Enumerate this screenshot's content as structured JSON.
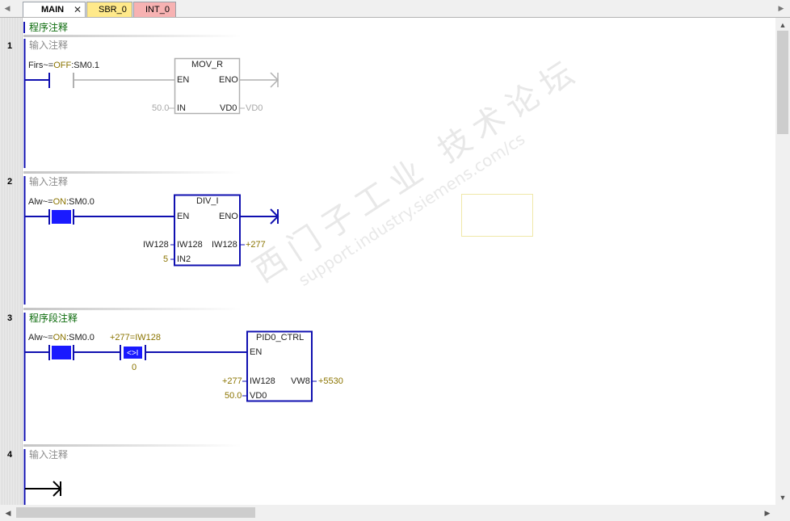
{
  "tabs": [
    {
      "label": "MAIN",
      "active": true,
      "closable": true
    },
    {
      "label": "SBR_0",
      "active": false
    },
    {
      "label": "INT_0",
      "active": false
    }
  ],
  "program_comment": "程序注释",
  "networks": [
    {
      "number": "1",
      "comment": "输入注释",
      "contact": {
        "label_prefix": "Firs~=",
        "state": "OFF",
        "address": ":SM0.1"
      },
      "box": {
        "name": "MOV_R",
        "en": "EN",
        "eno": "ENO",
        "in_label": "IN",
        "out_label": "VD0",
        "in_value": "50.0",
        "out_value": "VD0"
      }
    },
    {
      "number": "2",
      "comment": "输入注释",
      "contact": {
        "label_prefix": "Alw~=",
        "state": "ON",
        "address": ":SM0.0"
      },
      "box": {
        "name": "DIV_I",
        "en": "EN",
        "eno": "ENO",
        "in1_label": "IW128",
        "in2_label": "IN2",
        "out_label": "IW128",
        "in1_value": "IW128",
        "in2_value": "5",
        "out_value": "+277"
      }
    },
    {
      "number": "3",
      "comment": "程序段注释",
      "contact": {
        "label_prefix": "Alw~=",
        "state": "ON",
        "address": ":SM0.0"
      },
      "compare": {
        "label": "+277=IW128",
        "symbol": "<>I",
        "bottom": "0"
      },
      "box": {
        "name": "PID0_CTRL",
        "en": "EN",
        "in1_label": "IW128",
        "in2_label": "VD0",
        "out_label": "VW8",
        "in1_value": "+277",
        "in2_value": "50.0",
        "out_value": "+5530"
      }
    },
    {
      "number": "4",
      "comment": "输入注释"
    }
  ],
  "watermark": {
    "cn": "西门子工业  技术论坛",
    "url": "support.industry.siemens.com/cs"
  },
  "colors": {
    "active_blue": "#1010b0",
    "contact_fill": "#1a1aff",
    "inactive_gray": "#b0b0b0",
    "tab_main": "#ffffff",
    "tab_sbr": "#ffe98a",
    "tab_int": "#f7b2b2",
    "comment_green": "#0a6a0a"
  }
}
